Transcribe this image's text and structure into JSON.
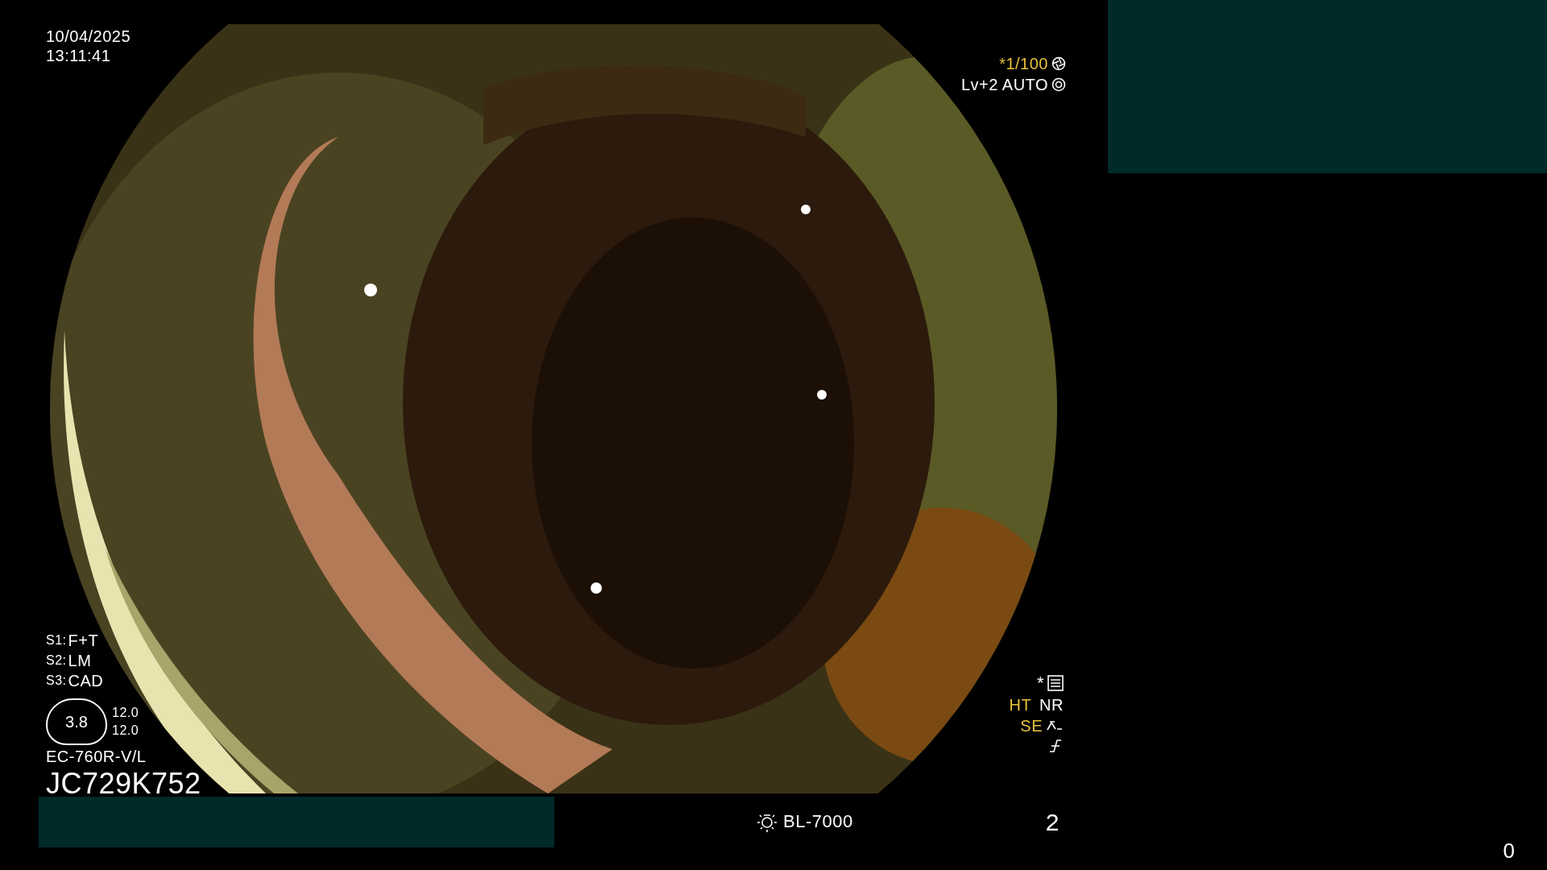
{
  "datetime": {
    "date": "10/04/2025",
    "time": "13:11:41"
  },
  "exposure": {
    "shutter": "*1/100",
    "mode": "Lv+2 AUTO"
  },
  "switches": [
    {
      "label": "S1:",
      "value": "F+T"
    },
    {
      "label": "S2:",
      "value": "LM"
    },
    {
      "label": "S3:",
      "value": "CAD"
    }
  ],
  "zoom_gauge": {
    "value": "3.8",
    "readings": [
      "12.0",
      "12.0"
    ]
  },
  "scope": {
    "model": "EC-760R-V/L",
    "serial": "JC729K752"
  },
  "preset_mark": "*",
  "enhancements": [
    {
      "label": "HT",
      "color": "#e8c23a"
    },
    {
      "label": "NR",
      "color": "#ffffff"
    }
  ],
  "edge": {
    "label": "SE",
    "color": "#e8c23a"
  },
  "light_source": "BL-7000",
  "channel": "2",
  "right_counter": "0"
}
